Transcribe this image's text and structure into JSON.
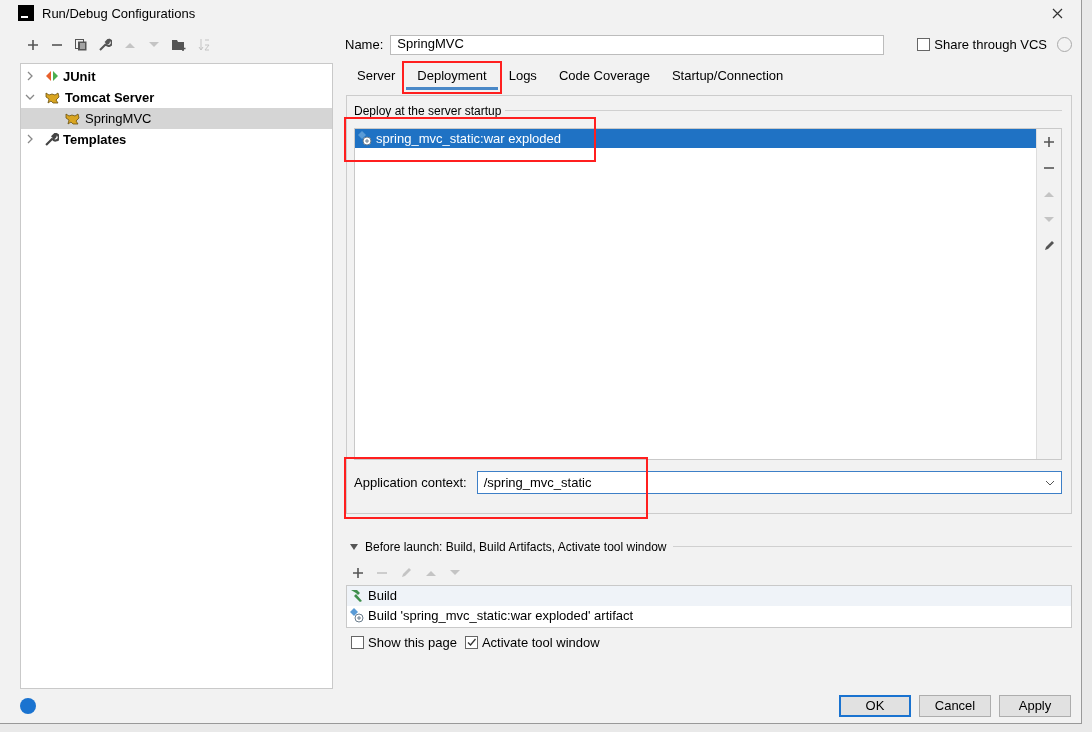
{
  "window": {
    "title": "Run/Debug Configurations"
  },
  "toolbar": [
    {
      "kind": "add",
      "disabled": false
    },
    {
      "kind": "remove",
      "disabled": false
    },
    {
      "kind": "copy",
      "disabled": false
    },
    {
      "kind": "edit",
      "disabled": false
    },
    {
      "kind": "up",
      "disabled": true
    },
    {
      "kind": "down",
      "disabled": true
    },
    {
      "kind": "folder",
      "disabled": false
    },
    {
      "kind": "sort",
      "disabled": true
    }
  ],
  "tree": [
    {
      "label": "JUnit",
      "kind": "junit",
      "expanded": false,
      "selected": false
    },
    {
      "label": "Tomcat Server",
      "kind": "tomcat",
      "expanded": true,
      "selected": false,
      "children": [
        {
          "label": "SpringMVC",
          "kind": "tomcat",
          "selected": true
        }
      ]
    },
    {
      "label": "Templates",
      "kind": "wrench",
      "expanded": false,
      "selected": false
    }
  ],
  "name_field": {
    "label": "Name:",
    "value": "SpringMVC"
  },
  "share": {
    "label": "Share through VCS",
    "checked": false
  },
  "tabs": [
    {
      "label": "Server",
      "selected": false,
      "highlighted": false
    },
    {
      "label": "Deployment",
      "selected": true,
      "highlighted": true
    },
    {
      "label": "Logs",
      "selected": false,
      "highlighted": false
    },
    {
      "label": "Code Coverage",
      "selected": false,
      "highlighted": false
    },
    {
      "label": "Startup/Connection",
      "selected": false,
      "highlighted": false
    }
  ],
  "deploy": {
    "title": "Deploy at the server startup",
    "items": [
      {
        "label": "spring_mvc_static:war exploded",
        "selected": true,
        "highlighted": true
      }
    ],
    "tools": [
      {
        "kind": "add",
        "disabled": false
      },
      {
        "kind": "remove",
        "disabled": false
      },
      {
        "kind": "up",
        "disabled": true
      },
      {
        "kind": "down",
        "disabled": true
      },
      {
        "kind": "pencil",
        "disabled": false
      }
    ]
  },
  "context": {
    "label": "Application context:",
    "value": "/spring_mvc_static",
    "highlighted": true
  },
  "before_launch": {
    "title": "Before launch: Build, Build Artifacts, Activate tool window",
    "expanded": true,
    "tools": [
      {
        "kind": "add",
        "disabled": false
      },
      {
        "kind": "remove",
        "disabled": true
      },
      {
        "kind": "pencil",
        "disabled": true
      },
      {
        "kind": "up",
        "disabled": true
      },
      {
        "kind": "down",
        "disabled": true
      }
    ],
    "items": [
      {
        "kind": "build",
        "label": "Build",
        "selected": true
      },
      {
        "kind": "artifact",
        "label": "Build 'spring_mvc_static:war exploded' artifact",
        "selected": false
      }
    ]
  },
  "options": [
    {
      "label": "Show this page",
      "checked": false
    },
    {
      "label": "Activate tool window",
      "checked": true
    }
  ],
  "buttons": [
    {
      "label": "OK",
      "default": true
    },
    {
      "label": "Cancel",
      "default": false
    },
    {
      "label": "Apply",
      "default": false
    }
  ]
}
